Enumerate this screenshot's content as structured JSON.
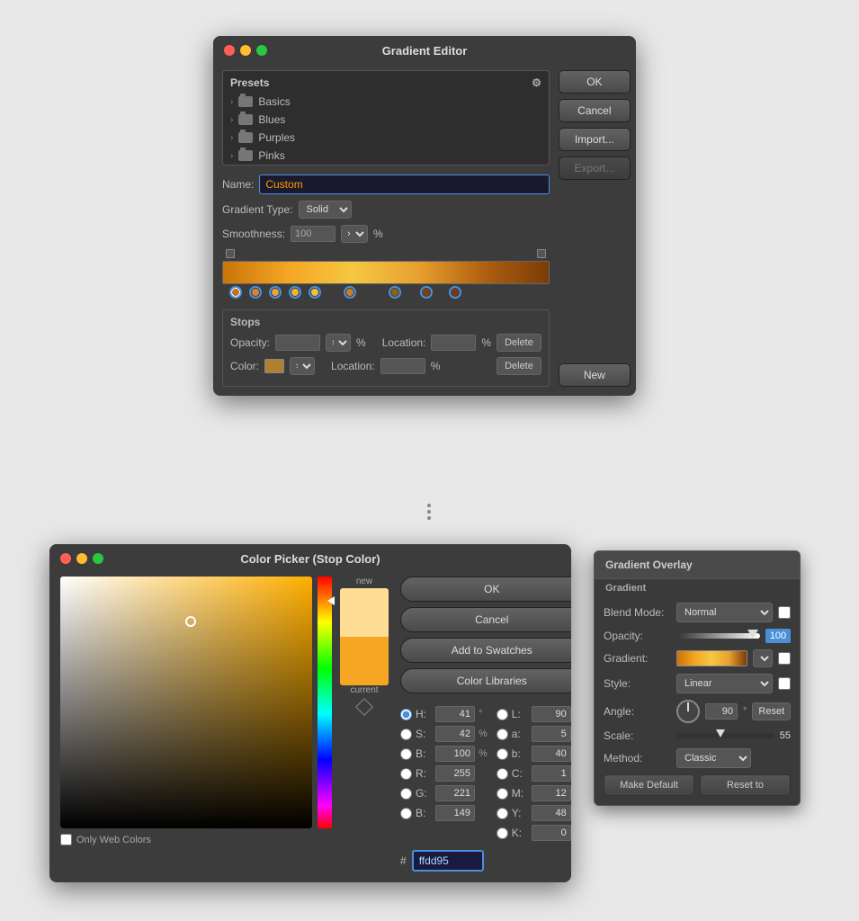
{
  "gradientEditor": {
    "title": "Gradient Editor",
    "presets": {
      "header": "Presets",
      "items": [
        {
          "label": "Basics"
        },
        {
          "label": "Blues"
        },
        {
          "label": "Purples"
        },
        {
          "label": "Pinks"
        }
      ]
    },
    "nameLabel": "Name:",
    "nameValue": "Custom",
    "gradientTypeLabel": "Gradient Type:",
    "gradientTypeValue": "Solid",
    "smoothnessLabel": "Smoothness:",
    "smoothnessValue": "100",
    "smoothnessUnit": "%",
    "stops": {
      "title": "Stops",
      "opacityLabel": "Opacity:",
      "opacityUnit": "%",
      "colorLabel": "Color:",
      "locationLabel": "Location:",
      "locationUnit": "%",
      "deleteLabel": "Delete"
    },
    "buttons": {
      "ok": "OK",
      "cancel": "Cancel",
      "import": "Import...",
      "export": "Export...",
      "new": "New"
    }
  },
  "colorPicker": {
    "title": "Color Picker (Stop Color)",
    "swatches": {
      "newLabel": "new",
      "currentLabel": "current"
    },
    "channels": {
      "hLabel": "H:",
      "hValue": "41",
      "hUnit": "°",
      "sLabel": "S:",
      "sValue": "42",
      "sUnit": "%",
      "bLabel": "B:",
      "bValue": "100",
      "bUnit": "%",
      "lLabel": "L:",
      "lValue": "90",
      "aLabel": "a:",
      "aValue": "5",
      "bLabCh": "b:",
      "bLabVal": "40",
      "rLabel": "R:",
      "rValue": "255",
      "cLabel": "C:",
      "cValue": "1",
      "cUnit": "%",
      "gLabel": "G:",
      "gValue": "221",
      "mLabel": "M:",
      "mValue": "12",
      "mUnit": "%",
      "bRgbLabel": "B:",
      "bRgbValue": "149",
      "yLabel": "Y:",
      "yValue": "48",
      "yUnit": "%",
      "kLabel": "K:",
      "kValue": "0",
      "kUnit": "%"
    },
    "hex": {
      "hash": "#",
      "value": "ffdd95"
    },
    "onlyWebColors": "Only Web Colors",
    "buttons": {
      "ok": "OK",
      "cancel": "Cancel",
      "addToSwatches": "Add to Swatches",
      "colorLibraries": "Color Libraries"
    }
  },
  "gradientOverlay": {
    "header": "Gradient Overlay",
    "subheader": "Gradient",
    "blendModeLabel": "Blend Mode:",
    "blendModeValue": "Normal",
    "opacityLabel": "Opacity:",
    "opacityValue": "100",
    "gradientLabel": "Gradient:",
    "styleLabel": "Style:",
    "styleValue": "Linear",
    "angleLabel": "Angle:",
    "angleValue": "90",
    "angleDeg": "°",
    "resetLabel": "Reset",
    "scaleLabel": "Scale:",
    "scaleValue": "55",
    "methodLabel": "Method:",
    "methodValue": "Classic",
    "makeDefaultLabel": "Make Default",
    "resetToLabel": "Reset to"
  }
}
